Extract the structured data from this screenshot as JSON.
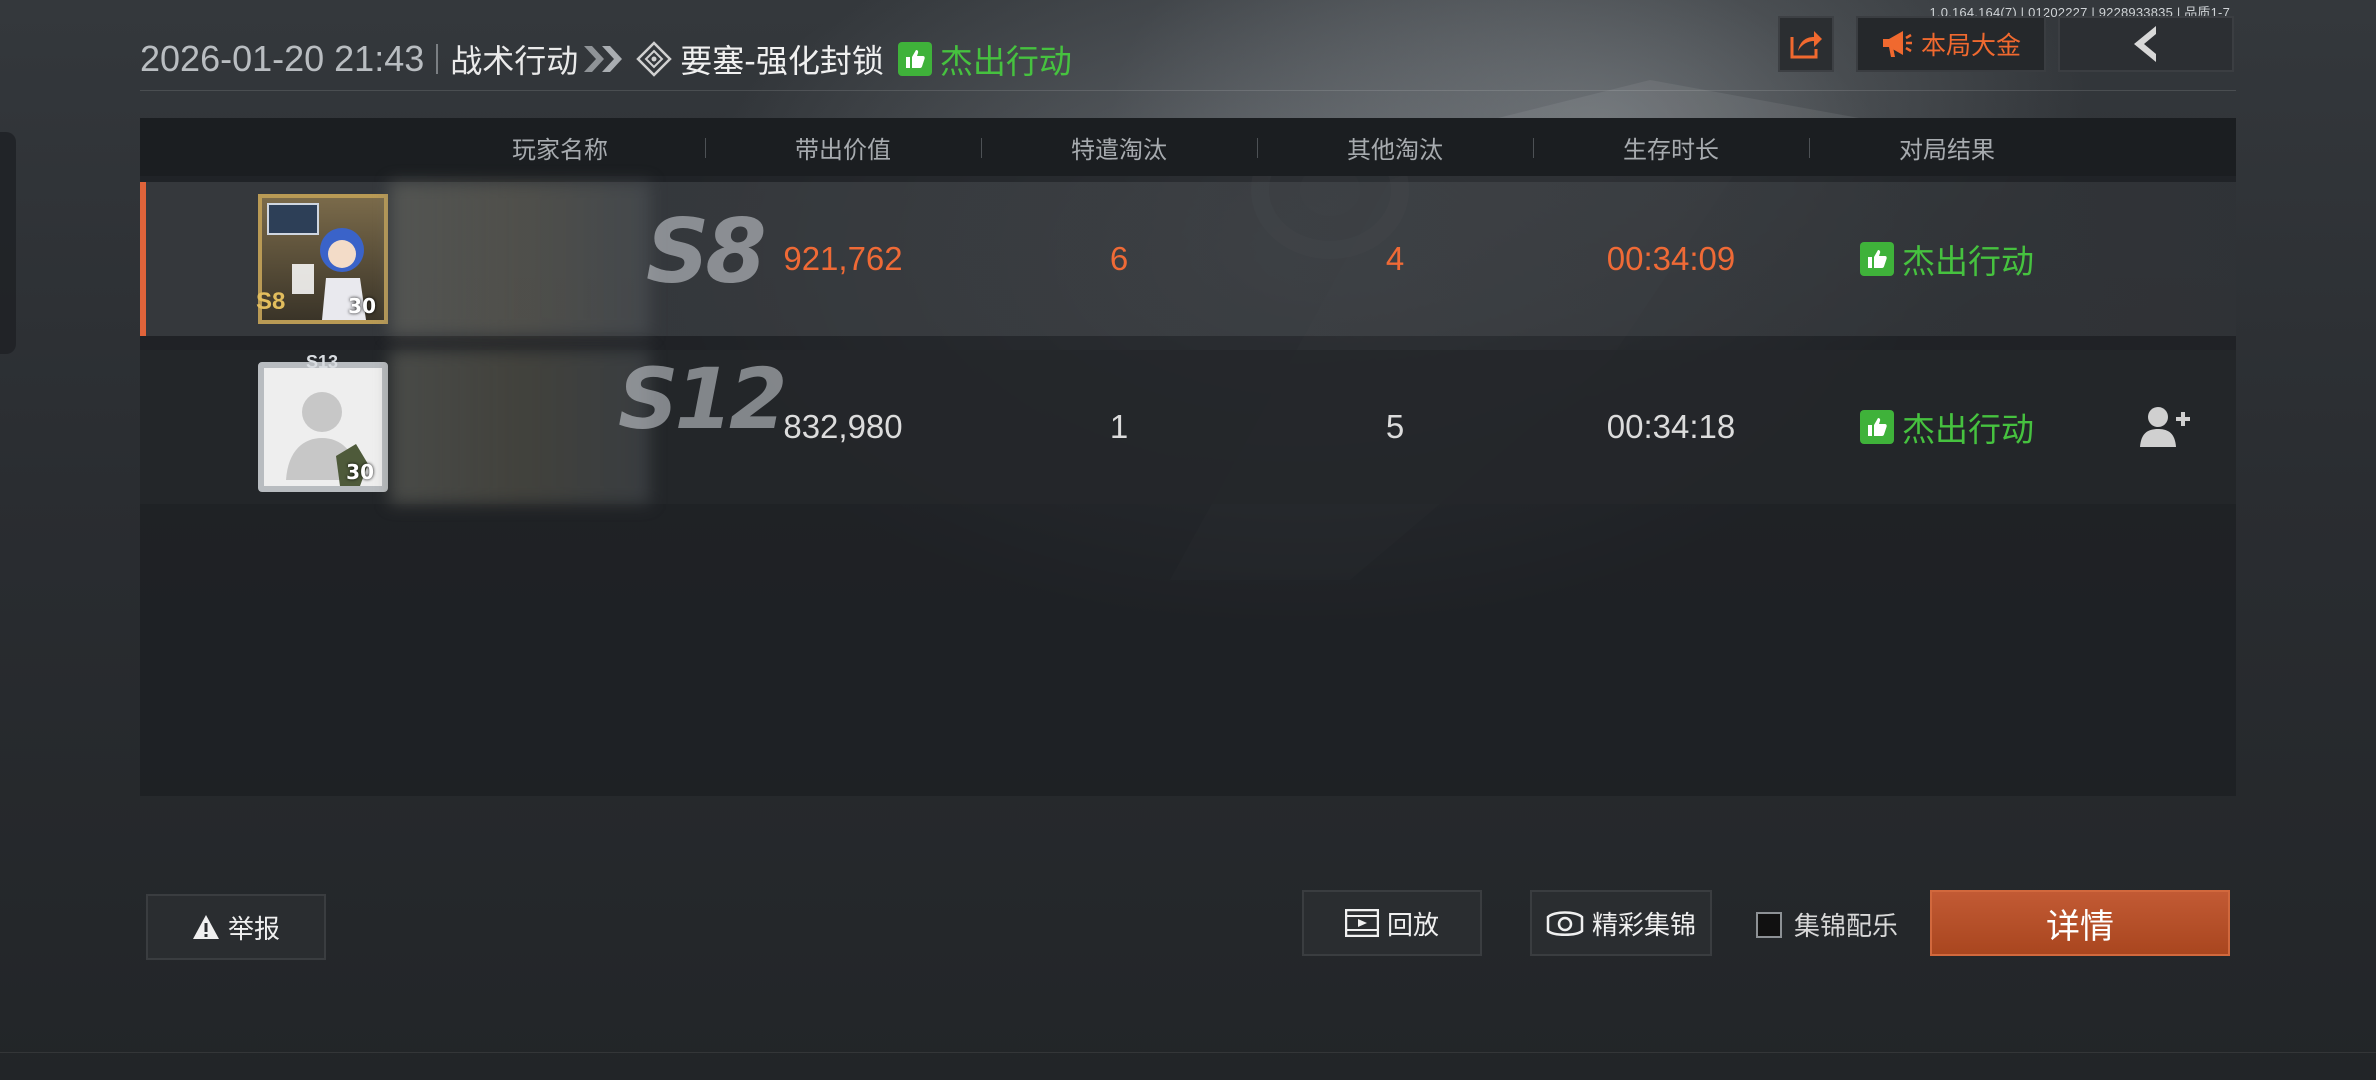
{
  "version_text": "1.0.164.164(7) | 01202227 | 9228933835 | 品质1-7",
  "header": {
    "datetime": "2026-01-20 21:43",
    "mode": "战术行动",
    "map": "要塞-强化封锁",
    "result": "杰出行动",
    "result_color": "#46c23f"
  },
  "top_buttons": {
    "share_icon": "share-icon",
    "announce_label": "本局大金",
    "announce_color": "#f0692f",
    "back_icon": "back-arrow-icon"
  },
  "table": {
    "headers": [
      "玩家名称",
      "带出价值",
      "特遣淘汰",
      "其他淘汰",
      "生存时长",
      "对局结果"
    ],
    "rows": [
      {
        "level": "30",
        "rank_badge": "S8",
        "season": "S8",
        "value": "921,762",
        "special_kills": "6",
        "other_kills": "4",
        "survival": "00:34:09",
        "result": "杰出行动",
        "highlighted": true
      },
      {
        "level": "30",
        "rank_badge": "S13",
        "season": "S12",
        "value": "832,980",
        "special_kills": "1",
        "other_kills": "5",
        "survival": "00:34:18",
        "result": "杰出行动",
        "highlighted": false
      }
    ],
    "highlight_color": "#ef6a36"
  },
  "bottom": {
    "report_label": "举报",
    "replay_label": "回放",
    "highlight_label": "精彩集锦",
    "music_label": "集锦配乐",
    "music_checked": false,
    "details_label": "详情",
    "details_color": "#b94f27"
  }
}
